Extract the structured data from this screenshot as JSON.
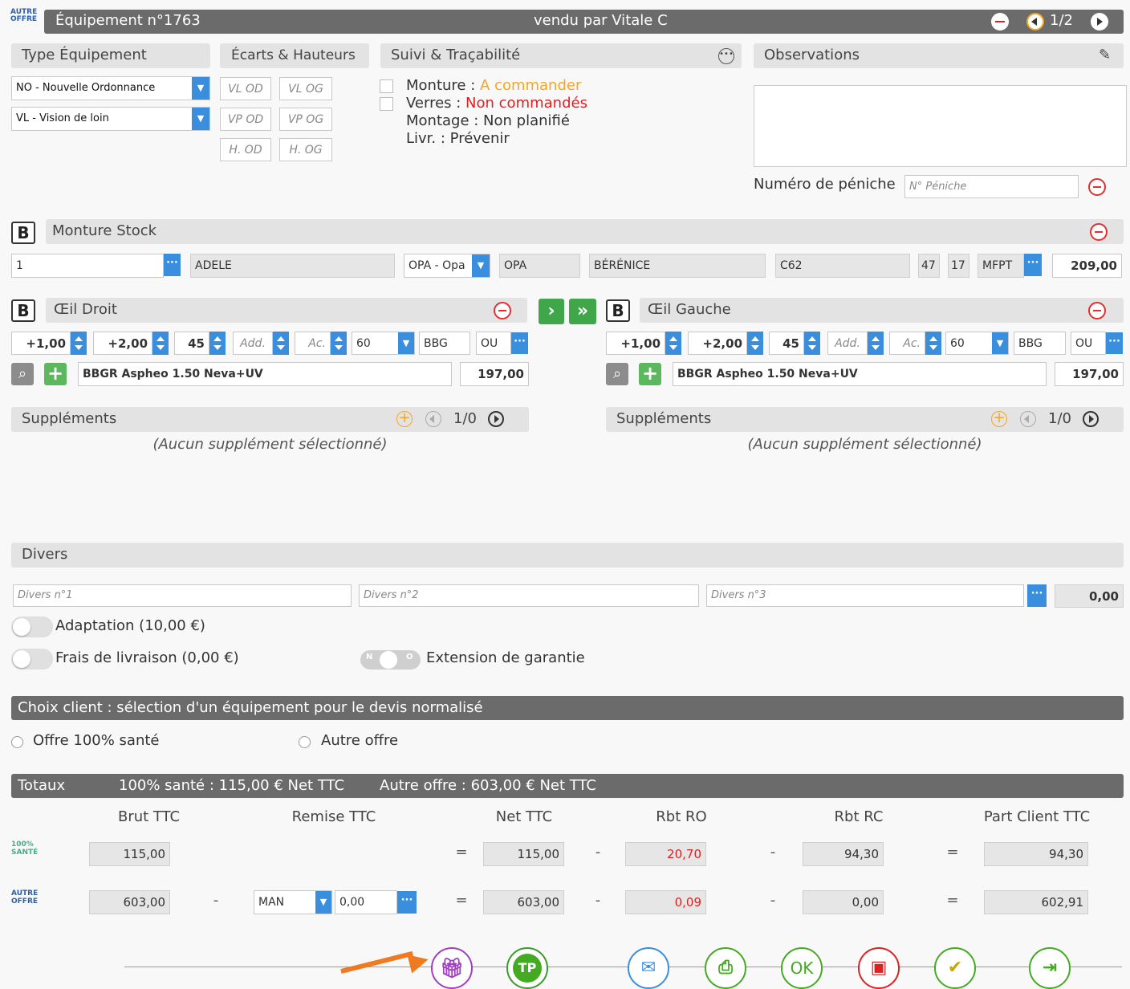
{
  "header": {
    "logo": "AUTRE OFFRE",
    "title": "Équipement n°1763",
    "seller": "vendu par Vitale C",
    "page": "1/2"
  },
  "type_equipement": {
    "title": "Type Équipement",
    "select1": "NO - Nouvelle Ordonnance",
    "select2": "VL - Vision de loin"
  },
  "ecarts": {
    "title": "Écarts & Hauteurs",
    "vl_od": "VL OD",
    "vl_og": "VL OG",
    "vp_od": "VP OD",
    "vp_og": "VP OG",
    "h_od": "H. OD",
    "h_og": "H. OG"
  },
  "suivi": {
    "title": "Suivi & Traçabilité",
    "monture_label": "Monture : ",
    "monture_status": "A commander",
    "verres_label": "Verres : ",
    "verres_status": "Non commandés",
    "montage": "Montage : Non planifié",
    "livr": "Livr. : Prévenir"
  },
  "observations": {
    "title": "Observations",
    "peniche_label": "Numéro de péniche",
    "peniche_placeholder": "N° Péniche"
  },
  "monture": {
    "badge": "B",
    "title": "Monture Stock",
    "ref": "1",
    "name": "ADELE",
    "supplier_select": "OPA - Opa",
    "supplier": "OPA",
    "model": "BÉRÉNICE",
    "color": "C62",
    "size1": "47",
    "size2": "17",
    "type": "MFPT",
    "price": "209,00"
  },
  "oeil_droit": {
    "badge": "B",
    "title": "Œil Droit",
    "sph": "+1,00",
    "cyl": "+2,00",
    "axe": "45",
    "add": "Add.",
    "ac": "Ac.",
    "diam": "60",
    "brand": "BBG",
    "ou": "OU",
    "lens": "BBGR Aspheo 1.50 Neva+UV",
    "price": "197,00",
    "supp_title": "Suppléments",
    "supp_page": "1/0",
    "supp_none": "(Aucun supplément sélectionné)"
  },
  "oeil_gauche": {
    "badge": "B",
    "title": "Œil Gauche",
    "sph": "+1,00",
    "cyl": "+2,00",
    "axe": "45",
    "add": "Add.",
    "ac": "Ac.",
    "diam": "60",
    "brand": "BBG",
    "ou": "OU",
    "lens": "BBGR Aspheo 1.50 Neva+UV",
    "price": "197,00",
    "supp_title": "Suppléments",
    "supp_page": "1/0",
    "supp_none": "(Aucun supplément sélectionné)"
  },
  "divers": {
    "title": "Divers",
    "p1": "Divers n°1",
    "p2": "Divers n°2",
    "p3": "Divers n°3",
    "total": "0,00"
  },
  "options": {
    "adaptation": "Adaptation (10,00 €)",
    "livraison": "Frais de livraison (0,00 €)",
    "extension": "Extension de garantie",
    "toggle_n": "N",
    "toggle_o": "O"
  },
  "choix": {
    "title": "Choix client : sélection d'un équipement pour le devis normalisé",
    "opt1": "Offre 100% santé",
    "opt2": "Autre offre"
  },
  "totaux": {
    "title": "Totaux",
    "sante": "100% santé : 115,00 € Net TTC",
    "autre": "Autre offre : 603,00 € Net TTC",
    "cols": [
      "Brut TTC",
      "Remise TTC",
      "Net TTC",
      "Rbt RO",
      "Rbt RC",
      "Part Client TTC"
    ],
    "row1": {
      "logo": "100% SANTÉ",
      "brut": "115,00",
      "net": "115,00",
      "ro": "20,70",
      "rc": "94,30",
      "part": "94,30"
    },
    "row2": {
      "logo": "AUTRE OFFRE",
      "brut": "603,00",
      "remise_type": "MAN",
      "remise": "0,00",
      "net": "603,00",
      "ro": "0,09",
      "rc": "0,00",
      "part": "602,91"
    },
    "eq": "=",
    "minus": "-"
  },
  "actions": {
    "tp": "TP",
    "ok": "OK"
  },
  "colors": {
    "header": "#6b6b6b",
    "accent": "#3a8ede",
    "orange": "#f5a623",
    "red": "#e02020",
    "green": "#44aa22"
  }
}
